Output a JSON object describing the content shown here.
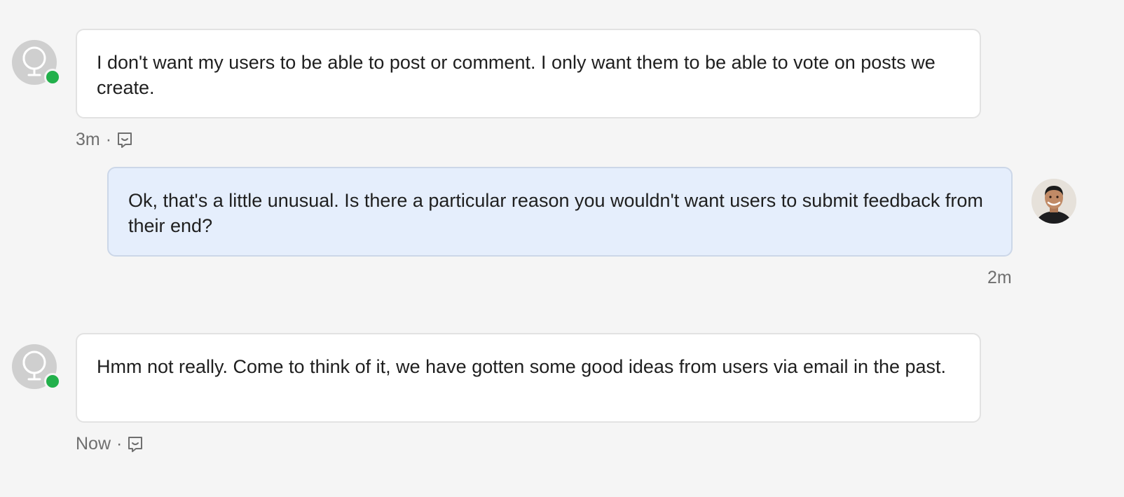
{
  "conversation": {
    "messages": [
      {
        "sender": "customer",
        "avatar_icon": "globe-icon",
        "status": "online",
        "text": "I don't want my users to be able to post or comment. I only want them to be able to vote on posts we create.",
        "time": "3m",
        "separator": "·",
        "meta_icon": "feedback-icon"
      },
      {
        "sender": "agent",
        "avatar_icon": "agent-photo",
        "text": "Ok, that's a little unusual. Is there a particular reason you wouldn't want users to submit feedback from their end?",
        "time": "2m"
      },
      {
        "sender": "customer",
        "avatar_icon": "globe-icon",
        "status": "online",
        "text": "Hmm not really. Come to think of it, we have gotten some good ideas from users via email in the past.",
        "time": "Now",
        "separator": "·",
        "meta_icon": "feedback-icon"
      }
    ]
  },
  "colors": {
    "background": "#f5f5f5",
    "incoming_bubble": "#ffffff",
    "outgoing_bubble": "#e5eefc",
    "online_status": "#22b04b",
    "meta_text": "#6f6f6f"
  }
}
